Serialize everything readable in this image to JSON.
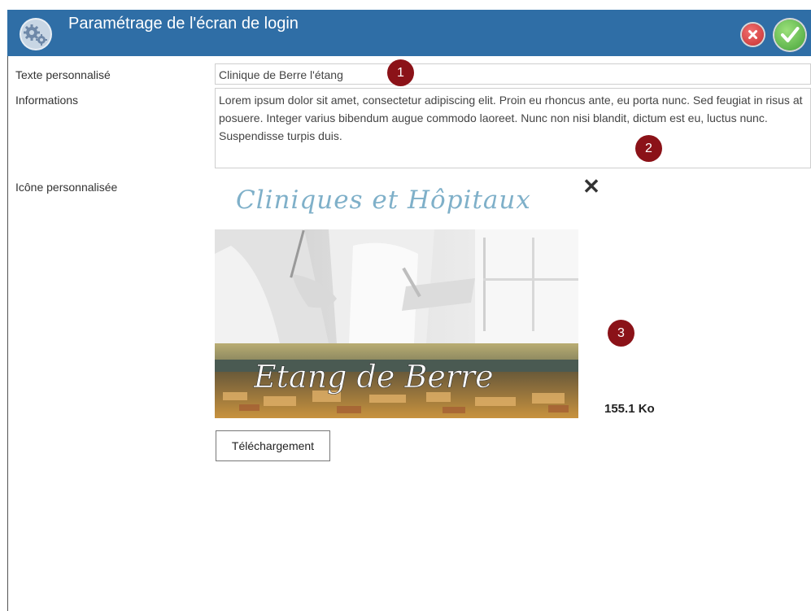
{
  "window": {
    "title": "Paramétrage de l'écran de login",
    "close_icon": "close-icon",
    "confirm_icon": "check-icon",
    "colors": {
      "titlebar": "#2f6ea6",
      "close": "#d84848",
      "confirm": "#5bb84a",
      "marker": "#8b1218"
    }
  },
  "form": {
    "custom_text_label": "Texte personnalisé",
    "custom_text_value": "Clinique de Berre l'étang",
    "info_label": "Informations",
    "info_value": "Lorem ipsum dolor sit amet, consectetur adipiscing elit. Proin eu rhoncus ante, eu porta nunc. Sed feugiat in risus at posuere. Integer varius bibendum augue commodo laoreet. Nunc non nisi blandit, dictum est eu, luctus nunc. Suspendisse turpis duis.",
    "icon_label": "Icône personnalisée",
    "remove_icon": "✕",
    "image_heading": "Cliniques et Hôpitaux",
    "image_caption": "Etang de Berre",
    "file_size": "155.1 Ko",
    "upload_label": "Téléchargement"
  },
  "markers": [
    "1",
    "2",
    "3"
  ]
}
